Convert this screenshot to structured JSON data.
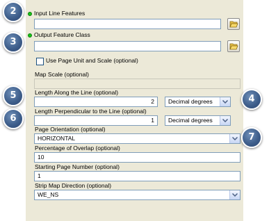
{
  "callouts": [
    "2",
    "3",
    "5",
    "6",
    "4",
    "7"
  ],
  "input_line_features": {
    "label": "Input Line Features",
    "value": ""
  },
  "output_feature_class": {
    "label": "Output Feature Class",
    "value": ""
  },
  "use_page_unit": {
    "label": "Use Page Unit and Scale (optional)",
    "checked": false
  },
  "map_scale": {
    "label": "Map Scale (optional)",
    "value": ""
  },
  "length_along": {
    "label": "Length Along the Line (optional)",
    "value": "2",
    "unit": "Decimal degrees"
  },
  "length_perpendicular": {
    "label": "Length Perpendicular to the Line (optional)",
    "value": "1",
    "unit": "Decimal degrees"
  },
  "page_orientation": {
    "label": "Page Orientation (optional)",
    "value": "HORIZONTAL"
  },
  "percentage_overlap": {
    "label": "Percentage of Overlap (optional)",
    "value": "10"
  },
  "starting_page_number": {
    "label": "Starting Page Number (optional)",
    "value": "1"
  },
  "strip_map_direction": {
    "label": "Strip Map Direction (optional)",
    "value": "WE_NS"
  },
  "colors": {
    "panel": "#ece9d8",
    "badge": "#3f5f8c",
    "required_dot": "#18c418",
    "field_border": "#7f9db9"
  },
  "icons": [
    "required-dot-icon",
    "folder-open-icon",
    "chevron-down-icon"
  ]
}
